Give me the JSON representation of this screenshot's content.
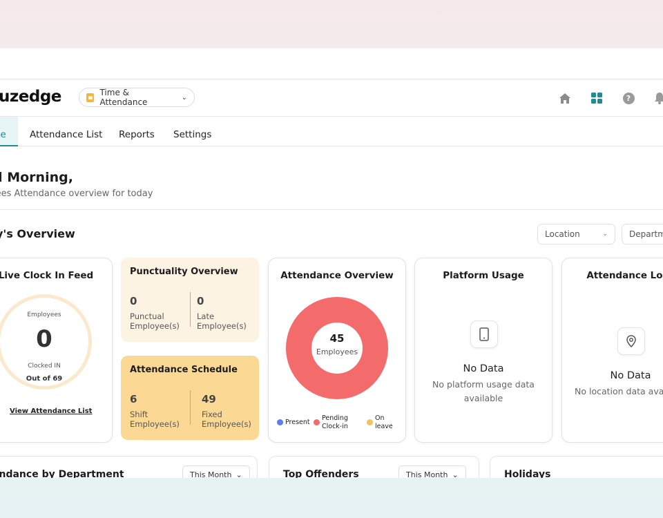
{
  "header": {
    "logo": "uzedge",
    "module": "Time & Attendance",
    "icons": [
      "home-icon",
      "apps-grid-icon",
      "help-icon",
      "bell-icon"
    ],
    "accent": "#1f8c94"
  },
  "tabs": [
    {
      "label": "ne",
      "active": true
    },
    {
      "label": "Attendance List"
    },
    {
      "label": "Reports"
    },
    {
      "label": "Settings"
    }
  ],
  "greeting": {
    "title": "d Morning,",
    "subtitle": "oyees Attendance overview for today"
  },
  "overview": {
    "title": "y's Overview",
    "filters": {
      "location": "Location",
      "department": "Departm"
    }
  },
  "live_feed": {
    "title": "Live Clock In Feed",
    "top_label": "Employees",
    "count": "0",
    "status": "Clocked IN",
    "out_of": "Out of 69",
    "link": "View Attendance List"
  },
  "punctuality": {
    "title": "Punctuality Overview",
    "punctual_count": "0",
    "punctual_label_1": "Punctual",
    "punctual_label_2": "Employee(s)",
    "late_count": "0",
    "late_label_1": "Late",
    "late_label_2": "Employee(s)"
  },
  "schedule": {
    "title": "Attendance Schedule",
    "shift_count": "6",
    "shift_label_1": "Shift",
    "shift_label_2": "Employee(s)",
    "fixed_count": "49",
    "fixed_label_1": "Fixed",
    "fixed_label_2": "Employee(s)"
  },
  "attendance_overview": {
    "title": "Attendance Overview",
    "total": "45",
    "total_label": "Employees",
    "legend": [
      {
        "label_1": "Present",
        "label_2": "",
        "color": "#5b7cf2"
      },
      {
        "label_1": "Pending",
        "label_2": "Clock-in",
        "color": "#f36b6b"
      },
      {
        "label_1": "On",
        "label_2": "leave",
        "color": "#f4c15a"
      }
    ]
  },
  "platform_usage": {
    "title": "Platform Usage",
    "empty_title": "No Data",
    "empty_text": "No platform usage data available"
  },
  "attendance_location": {
    "title": "Attendance Loca",
    "empty_title": "No Data",
    "empty_text": "No location data ava"
  },
  "bottom": {
    "dept_title": "endance by Department",
    "dept_period": "This Month",
    "offenders_title": "Top Offenders",
    "offenders_period": "This Month",
    "holidays_title": "Holidays"
  }
}
